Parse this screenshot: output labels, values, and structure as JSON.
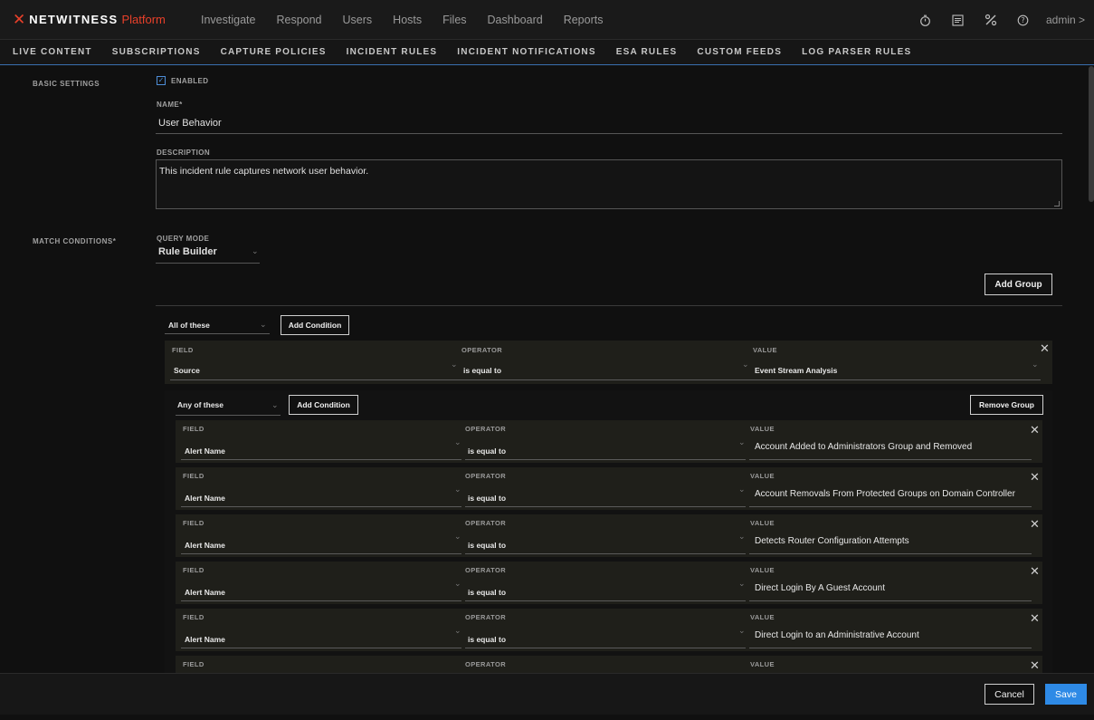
{
  "brand": {
    "name": "NETWITNESS",
    "product": "Platform"
  },
  "nav": [
    "Investigate",
    "Respond",
    "Users",
    "Hosts",
    "Files",
    "Dashboard",
    "Reports"
  ],
  "user": {
    "label": "admin >"
  },
  "top_icons": [
    "timer-icon",
    "task-list-icon",
    "tools-icon",
    "help-icon"
  ],
  "subnav": [
    "LIVE CONTENT",
    "SUBSCRIPTIONS",
    "CAPTURE POLICIES",
    "INCIDENT RULES",
    "INCIDENT NOTIFICATIONS",
    "ESA RULES",
    "CUSTOM FEEDS",
    "LOG PARSER RULES"
  ],
  "basic": {
    "section_label": "BASIC SETTINGS",
    "enabled_label": "ENABLED",
    "name_label": "NAME*",
    "name_value": "User Behavior",
    "description_label": "DESCRIPTION",
    "description_value": "This incident rule captures network user behavior."
  },
  "match": {
    "section_label": "MATCH CONDITIONS*",
    "query_mode_label": "QUERY MODE",
    "query_mode_value": "Rule Builder",
    "add_group": "Add Group"
  },
  "outer_group": {
    "combinator": "All of these",
    "add_condition": "Add Condition",
    "condition": {
      "field_label": "FIELD",
      "operator_label": "OPERATOR",
      "value_label": "VALUE",
      "field": "Source",
      "operator": "is equal to",
      "value": "Event Stream Analysis"
    }
  },
  "inner_group": {
    "combinator": "Any of these",
    "add_condition": "Add Condition",
    "remove_group": "Remove Group",
    "labels": {
      "field": "FIELD",
      "operator": "OPERATOR",
      "value": "VALUE"
    },
    "conditions": [
      {
        "field": "Alert Name",
        "operator": "is equal to",
        "value": "Account Added to Administrators Group and Removed"
      },
      {
        "field": "Alert Name",
        "operator": "is equal to",
        "value": "Account Removals From Protected Groups on Domain Controller"
      },
      {
        "field": "Alert Name",
        "operator": "is equal to",
        "value": "Detects Router Configuration Attempts"
      },
      {
        "field": "Alert Name",
        "operator": "is equal to",
        "value": "Direct Login By A Guest Account"
      },
      {
        "field": "Alert Name",
        "operator": "is equal to",
        "value": "Direct Login to an Administrative Account"
      }
    ]
  },
  "footer": {
    "cancel": "Cancel",
    "save": "Save"
  },
  "colors": {
    "accent": "#2e8ae6",
    "brand": "#e8402a",
    "background": "#101010"
  }
}
